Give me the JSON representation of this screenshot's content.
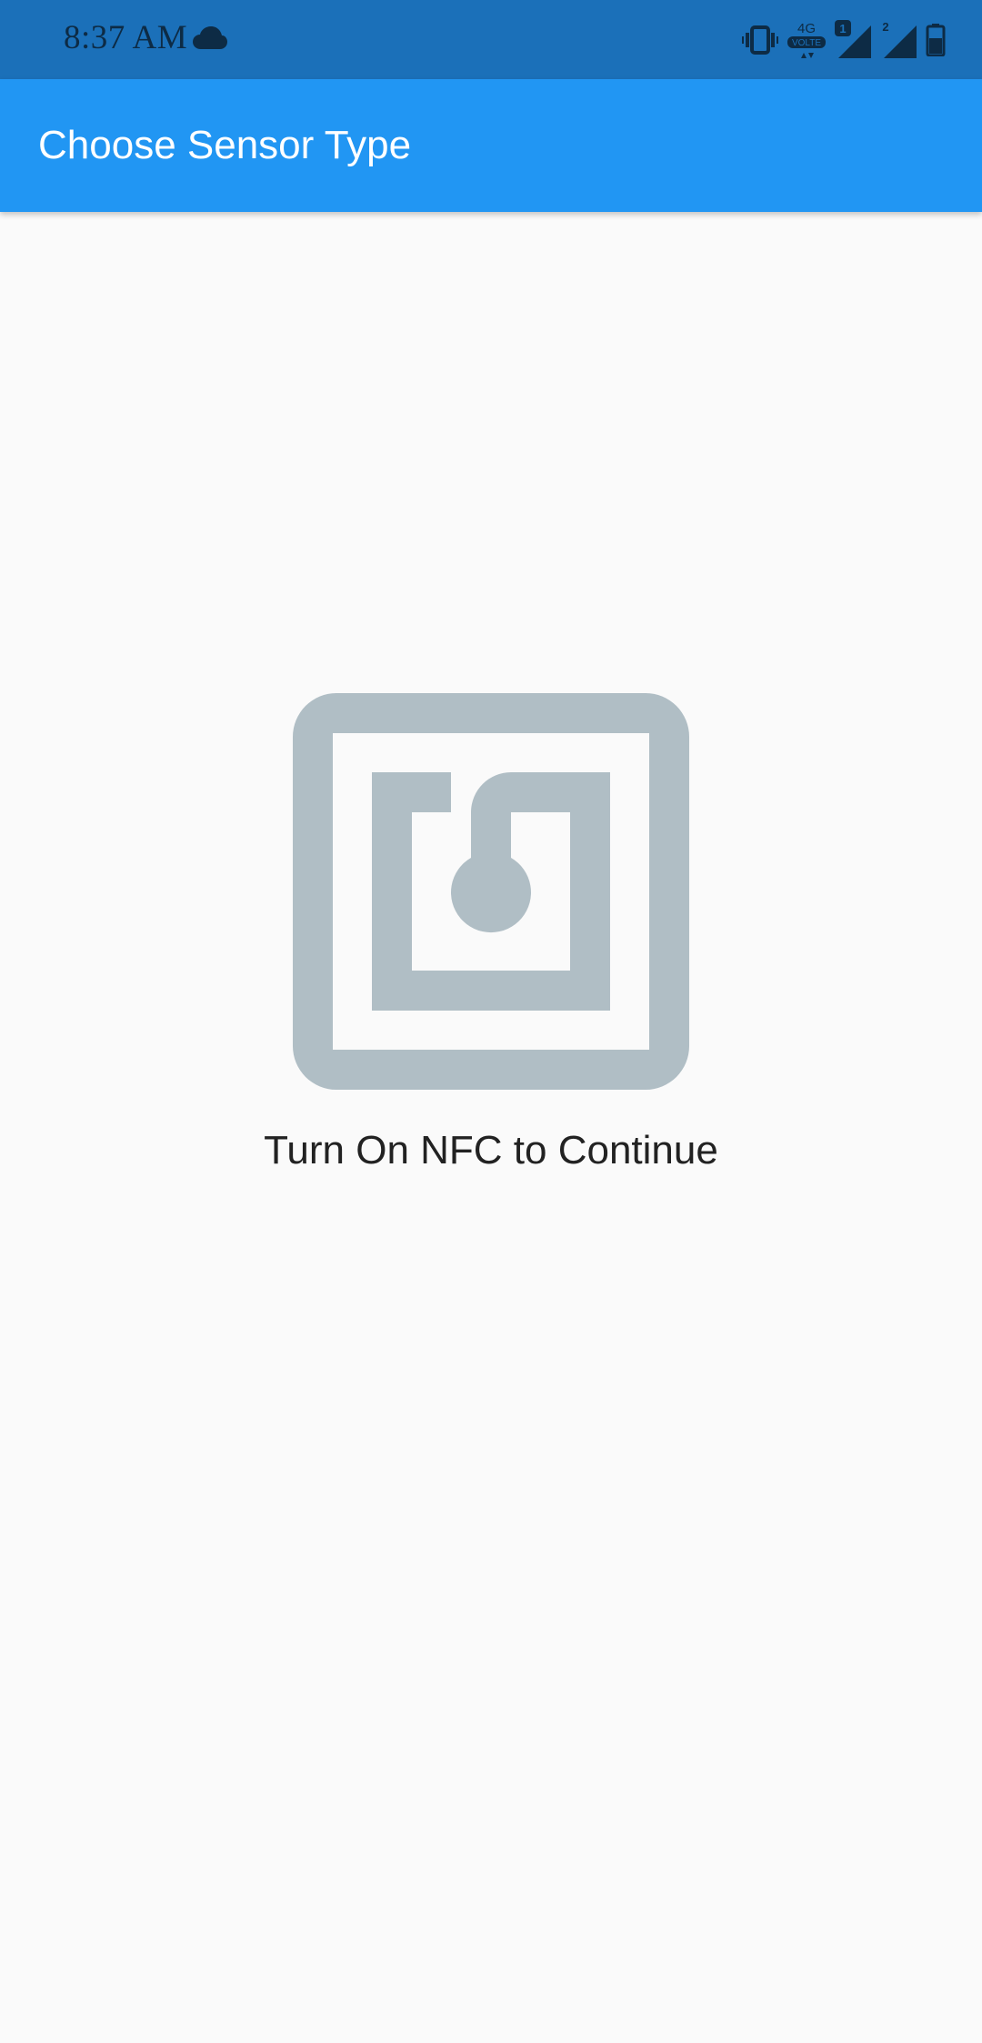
{
  "status_bar": {
    "time": "8:37 AM",
    "network_label": "4G",
    "volte_label": "VOLTE",
    "sim1_label": "1",
    "sim2_label": "2",
    "icons": [
      "cloud-icon",
      "vibrate-icon",
      "signal-icon",
      "battery-icon"
    ],
    "background_color": "#1b70b9"
  },
  "app_bar": {
    "title": "Choose Sensor Type",
    "background_color": "#2196f3"
  },
  "main": {
    "icon": "nfc-icon",
    "icon_color": "#b0bec5",
    "message": "Turn On NFC to Continue"
  }
}
